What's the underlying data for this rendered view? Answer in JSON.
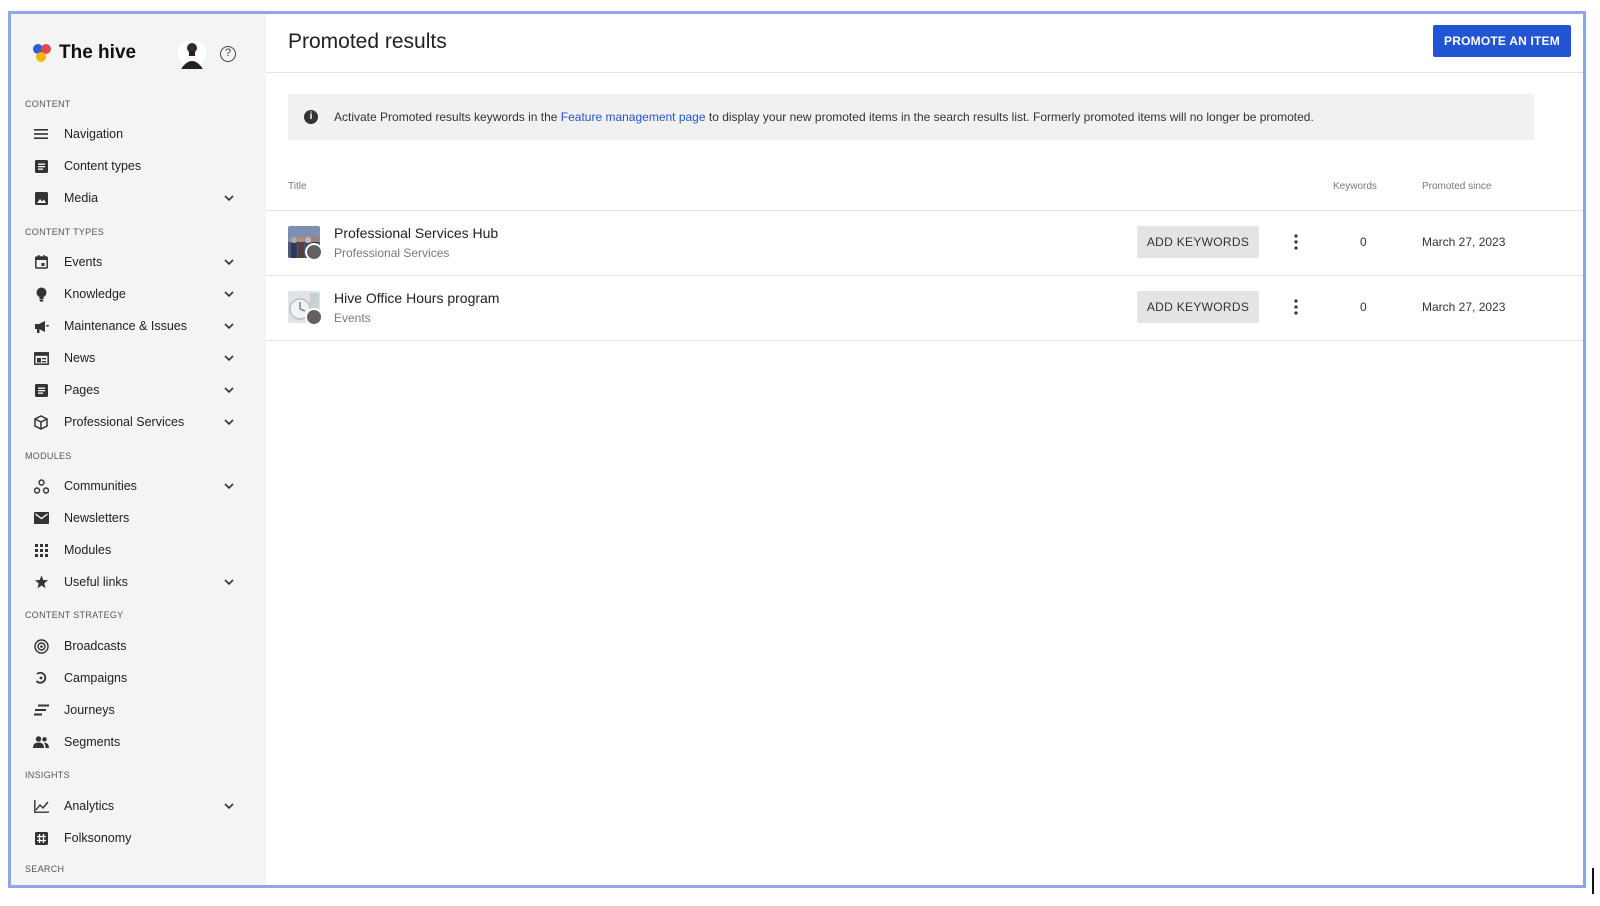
{
  "brand": {
    "name": "The hive"
  },
  "sidebar": {
    "sections": [
      {
        "label": "CONTENT"
      },
      {
        "label": "CONTENT TYPES"
      },
      {
        "label": "MODULES"
      },
      {
        "label": "CONTENT STRATEGY"
      },
      {
        "label": "INSIGHTS"
      },
      {
        "label": "SEARCH"
      }
    ],
    "items": [
      {
        "label": "Navigation",
        "icon": "menu-icon",
        "expandable": false
      },
      {
        "label": "Content types",
        "icon": "document-icon",
        "expandable": false
      },
      {
        "label": "Media",
        "icon": "image-icon",
        "expandable": true
      },
      {
        "label": "Events",
        "icon": "calendar-icon",
        "expandable": true
      },
      {
        "label": "Knowledge",
        "icon": "lightbulb-icon",
        "expandable": true
      },
      {
        "label": "Maintenance & Issues",
        "icon": "megaphone-icon",
        "expandable": true
      },
      {
        "label": "News",
        "icon": "news-icon",
        "expandable": true
      },
      {
        "label": "Pages",
        "icon": "page-icon",
        "expandable": true
      },
      {
        "label": "Professional Services",
        "icon": "cube-icon",
        "expandable": true
      },
      {
        "label": "Communities",
        "icon": "communities-icon",
        "expandable": true
      },
      {
        "label": "Newsletters",
        "icon": "envelope-icon",
        "expandable": false
      },
      {
        "label": "Modules",
        "icon": "grid-icon",
        "expandable": false
      },
      {
        "label": "Useful links",
        "icon": "star-icon",
        "expandable": true
      },
      {
        "label": "Broadcasts",
        "icon": "broadcast-icon",
        "expandable": false
      },
      {
        "label": "Campaigns",
        "icon": "campaign-icon",
        "expandable": false
      },
      {
        "label": "Journeys",
        "icon": "journey-icon",
        "expandable": false
      },
      {
        "label": "Segments",
        "icon": "people-icon",
        "expandable": false
      },
      {
        "label": "Analytics",
        "icon": "chart-icon",
        "expandable": true
      },
      {
        "label": "Folksonomy",
        "icon": "hashtag-icon",
        "expandable": false
      }
    ]
  },
  "main": {
    "title": "Promoted results",
    "promote_button": "PROMOTE AN ITEM",
    "banner": {
      "text_before": "Activate Promoted results keywords in the ",
      "link": "Feature management page",
      "text_after": " to display your new promoted items in the search results list. Formerly promoted items will no longer be promoted."
    },
    "columns": {
      "title": "Title",
      "keywords": "Keywords",
      "promoted_since": "Promoted since"
    },
    "rows": [
      {
        "title": "Professional Services Hub",
        "type": "Professional Services",
        "button": "ADD KEYWORDS",
        "keywords": "0",
        "date": "March 27, 2023"
      },
      {
        "title": "Hive Office Hours program",
        "type": "Events",
        "button": "ADD KEYWORDS",
        "keywords": "0",
        "date": "March 27, 2023"
      }
    ]
  },
  "colors": {
    "accent": "#2255d4",
    "sidebar_bg": "#f4f4f4",
    "frame": "#8ea6e6"
  }
}
